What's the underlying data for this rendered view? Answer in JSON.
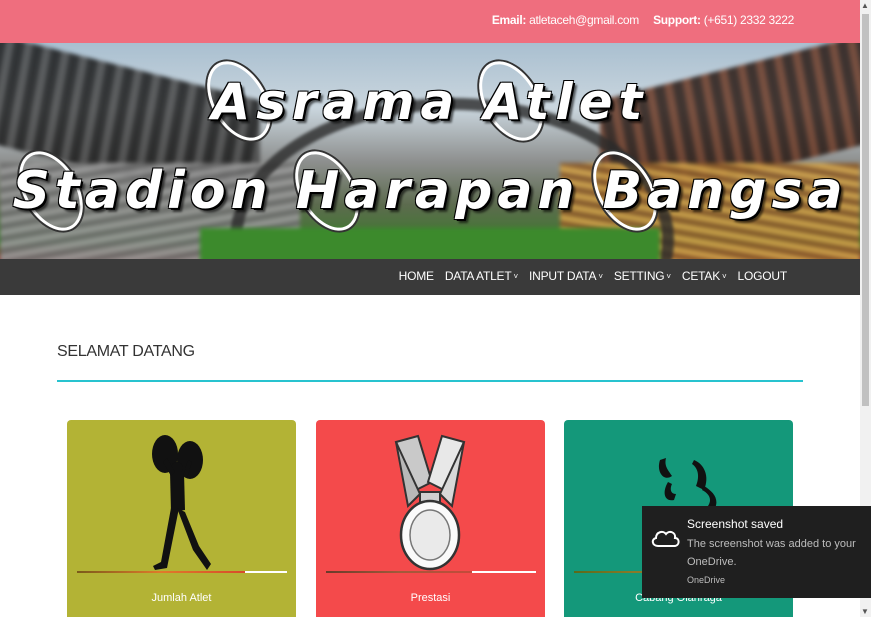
{
  "topbar": {
    "email_label": "Email:",
    "email_value": "atletaceh@gmail.com",
    "support_label": "Support:",
    "support_value": "(+651) 2332 3222"
  },
  "banner": {
    "line1": "Asrama Atlet",
    "line2": "Stadion Harapan Bangsa"
  },
  "nav": {
    "items": [
      {
        "label": "HOME",
        "dropdown": false
      },
      {
        "label": "DATA ATLET",
        "dropdown": true
      },
      {
        "label": "INPUT DATA",
        "dropdown": true
      },
      {
        "label": "SETTING",
        "dropdown": true
      },
      {
        "label": "CETAK",
        "dropdown": true
      },
      {
        "label": "LOGOUT",
        "dropdown": false
      }
    ],
    "chevron": "˅"
  },
  "main": {
    "heading": "SELAMAT DATANG",
    "cards": [
      {
        "label": "Jumlah Atlet",
        "icon": "weightlifter-icon",
        "color": "#b3b335"
      },
      {
        "label": "Prestasi",
        "icon": "medal-icon",
        "color": "#f44a4b"
      },
      {
        "label": "Cabang Olahraga",
        "icon": "athlete-icon",
        "color": "#14987a"
      }
    ]
  },
  "colors": {
    "topbar": "#ef6e7e",
    "navbar": "#3a3a3a",
    "accent_rule": "#28c3cf"
  },
  "toast": {
    "title": "Screenshot saved",
    "body": "The screenshot was added to your OneDrive.",
    "source": "OneDrive",
    "icon": "onedrive-cloud-icon"
  }
}
